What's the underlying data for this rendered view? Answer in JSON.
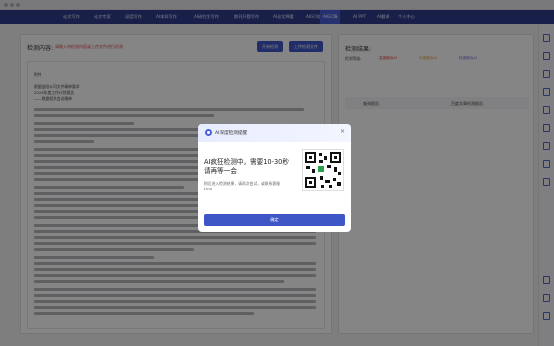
{
  "nav": {
    "items": [
      "论文写作",
      "论文专家",
      "深度写作",
      "AI本科写作",
      "AI研究生写作",
      "期刊开题写作",
      "AI论文降重",
      "AIGC检测",
      "AIGC降",
      "AI PPT",
      "AI翻译",
      "个人中心"
    ],
    "active_index": 8
  },
  "main": {
    "title": "检测内容:",
    "hint": "请输入待检测内容或上传文件进行检测",
    "buttons": [
      "开始检测",
      "上传检测文件"
    ],
    "doc_heading": "附件",
    "doc_lines": [
      "根据益阳公司文件精神要求",
      "2024年度工作计划报告",
      "——根据相关会议精神"
    ]
  },
  "result": {
    "title": "检测结果:",
    "legend_label": "检测等级:",
    "legend_items": [
      "高度疑似AI",
      "中度疑似AI",
      "轻度疑似AI"
    ],
    "col_left": "查询报告",
    "col_right": "百度文章检测报告"
  },
  "modal": {
    "title": "AI深度检测提醒",
    "close_icon": "close-icon",
    "main_text": "AI疯狂检测中，需要10-30秒请再等一会",
    "sub_text": "稍后进入检测结果，请再次尝试，或联系客服Lino",
    "confirm_label": "确定"
  },
  "colors": {
    "accent": "#3f56c7",
    "nav_bg": "#2f3e8f",
    "hint_red": "#e04848"
  }
}
